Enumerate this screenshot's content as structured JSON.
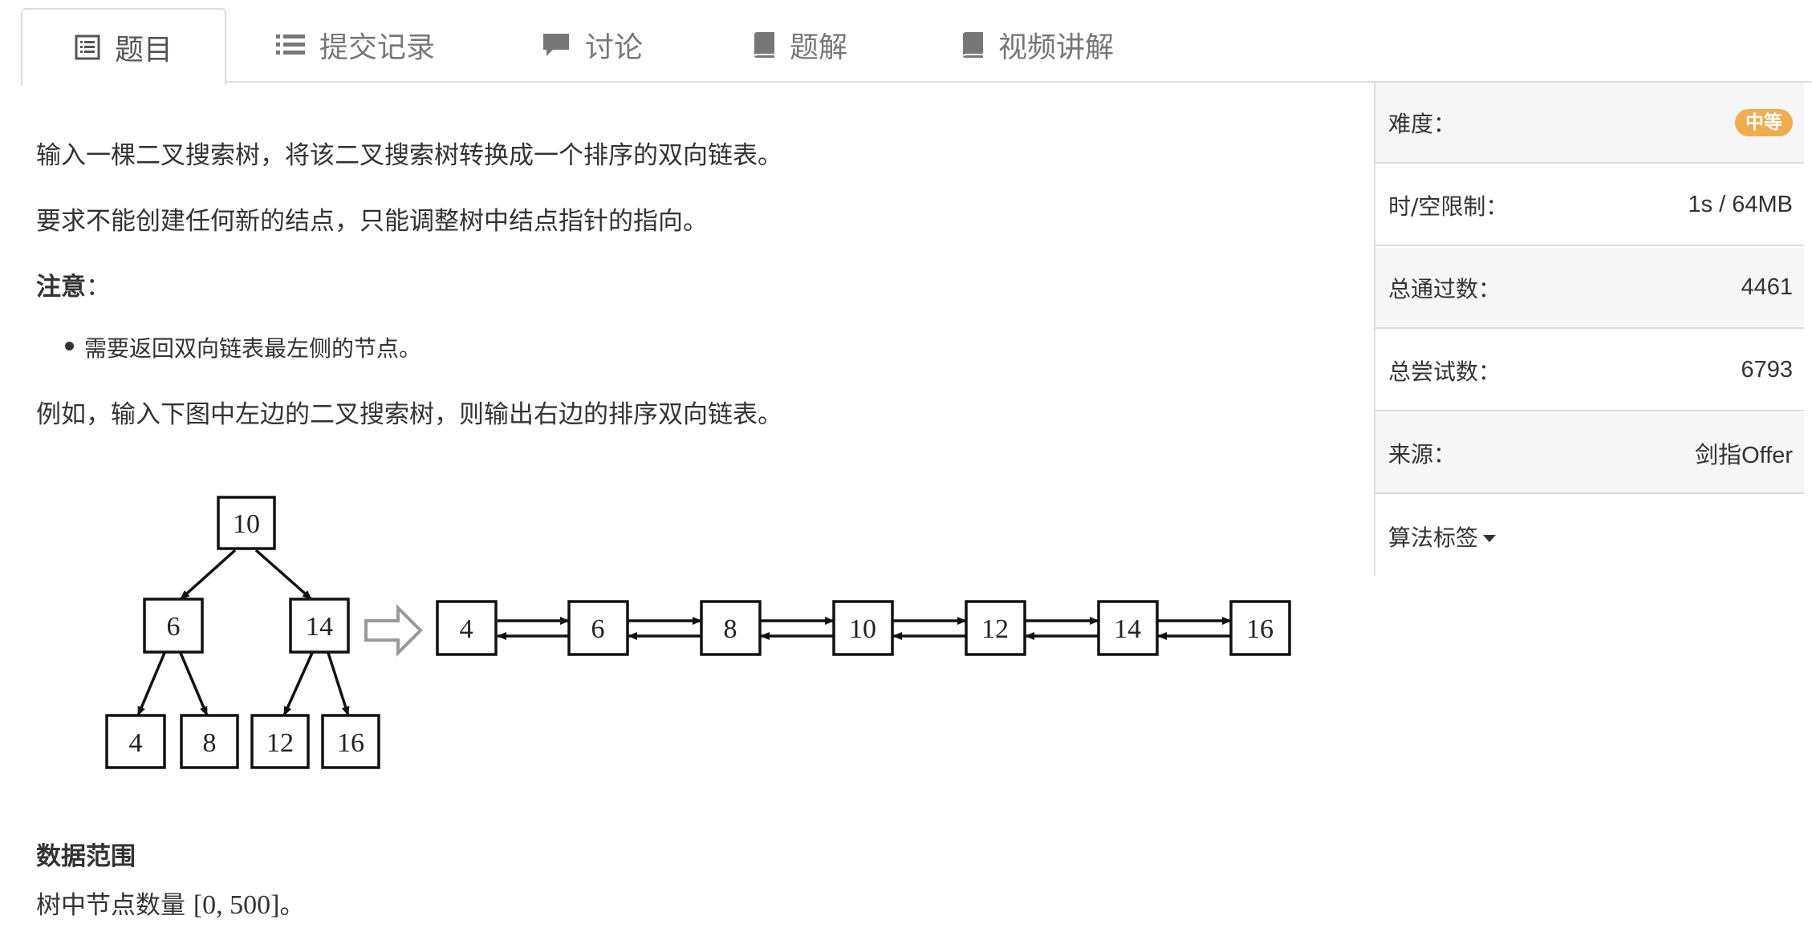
{
  "tabs": [
    {
      "label": "题目",
      "icon": "list-doc-icon",
      "active": true
    },
    {
      "label": "提交记录",
      "icon": "list-icon",
      "active": false
    },
    {
      "label": "讨论",
      "icon": "comment-icon",
      "active": false
    },
    {
      "label": "题解",
      "icon": "book-icon",
      "active": false
    },
    {
      "label": "视频讲解",
      "icon": "book-icon",
      "active": false
    }
  ],
  "problem": {
    "p1": "输入一棵二叉搜索树，将该二叉搜索树转换成一个排序的双向链表。",
    "p2": "要求不能创建任何新的结点，只能调整树中结点指针的指向。",
    "note_title": "注意",
    "note_colon": "：",
    "note_item": "需要返回双向链表最左侧的节点。",
    "p3": "例如，输入下图中左边的二叉搜索树，则输出右边的排序双向链表。",
    "range_title": "数据范围",
    "range_text_cn": "树中节点数量 ",
    "range_text_num": "[0, 500]",
    "range_text_end": "。"
  },
  "figure": {
    "tree": {
      "root": "10",
      "left": "6",
      "right": "14",
      "ll": "4",
      "lr": "8",
      "rl": "12",
      "rr": "16"
    },
    "list": [
      "4",
      "6",
      "8",
      "10",
      "12",
      "14",
      "16"
    ]
  },
  "sidebar": {
    "difficulty_label": "难度：",
    "difficulty_value": "中等",
    "limit_label": "时/空限制：",
    "limit_value": "1s / 64MB",
    "pass_label": "总通过数：",
    "pass_value": "4461",
    "try_label": "总尝试数：",
    "try_value": "6793",
    "source_label": "来源：",
    "source_value": "剑指Offer",
    "tags_label": "算法标签"
  },
  "colors": {
    "badge": "#f0ad4e",
    "border": "#dddddd",
    "row_shade": "#f6f6f6"
  }
}
